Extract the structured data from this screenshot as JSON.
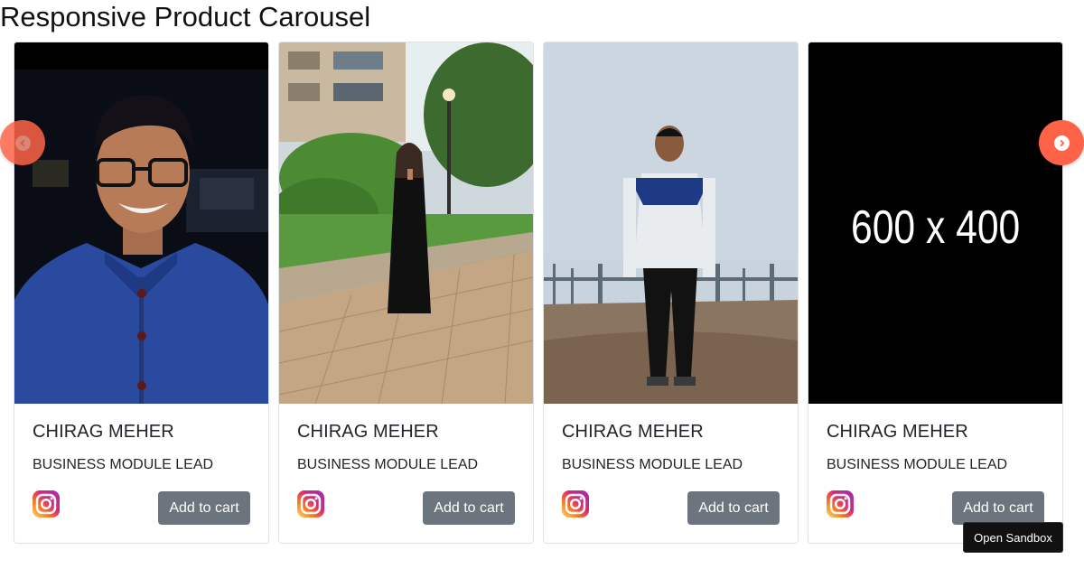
{
  "page": {
    "title": "Responsive Product Carousel"
  },
  "carousel": {
    "prev_icon": "chevron-left-icon",
    "next_icon": "chevron-right-icon",
    "accent_color": "#ff6347",
    "cards": [
      {
        "name": "CHIRAG MEHER",
        "role": "BUSINESS MODULE LEAD",
        "button": "Add to cart",
        "icon": "instagram-icon",
        "image": "photo-man-blue-jacket"
      },
      {
        "name": "CHIRAG MEHER",
        "role": "BUSINESS MODULE LEAD",
        "button": "Add to cart",
        "icon": "instagram-icon",
        "image": "photo-woman-black-dress"
      },
      {
        "name": "CHIRAG MEHER",
        "role": "BUSINESS MODULE LEAD",
        "button": "Add to cart",
        "icon": "instagram-icon",
        "image": "photo-man-white-shirt"
      },
      {
        "name": "CHIRAG MEHER",
        "role": "BUSINESS MODULE LEAD",
        "button": "Add to cart",
        "icon": "instagram-icon",
        "image": "placeholder-image",
        "placeholder_text": "600 x 400"
      }
    ]
  },
  "sandbox": {
    "label": "Open Sandbox"
  }
}
